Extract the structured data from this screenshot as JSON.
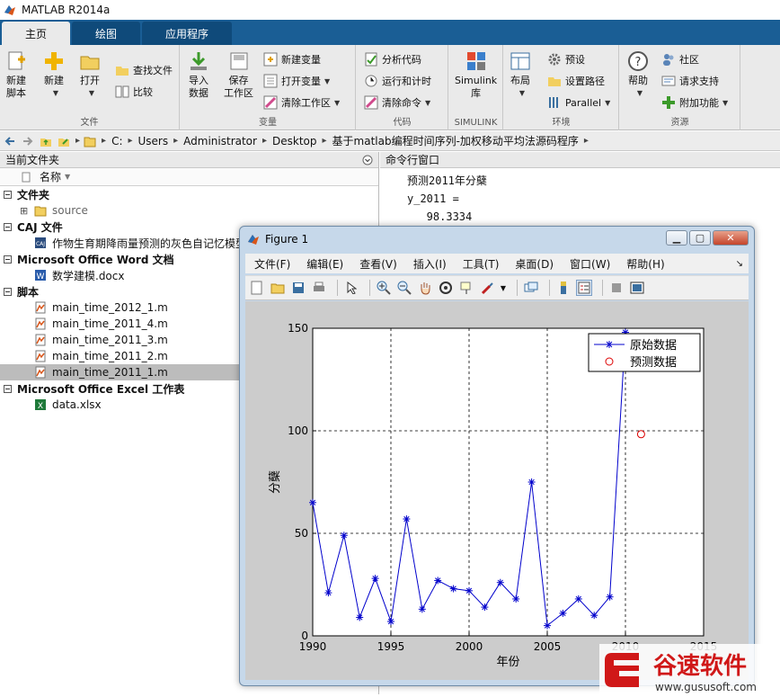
{
  "window": {
    "title": "MATLAB R2014a"
  },
  "tabs": [
    {
      "label": "主页"
    },
    {
      "label": "绘图"
    },
    {
      "label": "应用程序"
    }
  ],
  "ribbon": {
    "file": {
      "group_label": "文件",
      "new_script": "新建\n脚本",
      "new": "新建",
      "open": "打开",
      "find_files": "查找文件",
      "compare": "比较"
    },
    "variable": {
      "group_label": "变量",
      "import_data": "导入\n数据",
      "save_workspace": "保存\n工作区",
      "new_variable": "新建变量",
      "open_variable": "打开变量",
      "clear_workspace": "清除工作区"
    },
    "code": {
      "group_label": "代码",
      "analyze_code": "分析代码",
      "run_and_time": "运行和计时",
      "clear_commands": "清除命令"
    },
    "simulink": {
      "group_label": "SIMULINK",
      "library": "Simulink\n库"
    },
    "environment": {
      "group_label": "环境",
      "layout": "布局",
      "preferences": "预设",
      "set_path": "设置路径",
      "parallel": "Parallel"
    },
    "resources": {
      "group_label": "资源",
      "help": "帮助",
      "community": "社区",
      "request_support": "请求支持",
      "add_ons": "附加功能"
    }
  },
  "address": {
    "crumbs": [
      "C:",
      "Users",
      "Administrator",
      "Desktop",
      "基于matlab编程时间序列-加权移动平均法源码程序"
    ]
  },
  "current_folder": {
    "title": "当前文件夹",
    "column_name": "名称",
    "groups": [
      {
        "title": "文件夹",
        "items": [
          {
            "name": "source",
            "icon": "folder-icon"
          }
        ]
      },
      {
        "title": "CAJ 文件",
        "items": [
          {
            "name": "作物生育期降雨量预测的灰色自记忆模型",
            "icon": "caj-icon"
          }
        ]
      },
      {
        "title": "Microsoft Office Word 文档",
        "items": [
          {
            "name": "数学建模.docx",
            "icon": "word-icon"
          }
        ]
      },
      {
        "title": "脚本",
        "items": [
          {
            "name": "main_time_2012_1.m",
            "icon": "m-file-icon"
          },
          {
            "name": "main_time_2011_4.m",
            "icon": "m-file-icon"
          },
          {
            "name": "main_time_2011_3.m",
            "icon": "m-file-icon"
          },
          {
            "name": "main_time_2011_2.m",
            "icon": "m-file-icon"
          },
          {
            "name": "main_time_2011_1.m",
            "icon": "m-file-icon",
            "selected": true
          }
        ]
      },
      {
        "title": "Microsoft Office Excel 工作表",
        "items": [
          {
            "name": "data.xlsx",
            "icon": "excel-icon"
          }
        ]
      }
    ]
  },
  "command_window": {
    "title": "命令行窗口",
    "lines": [
      "预测2011年分蘖",
      "y_2011 =",
      "   98.3334"
    ]
  },
  "figure": {
    "title": "Figure 1",
    "menu": [
      "文件(F)",
      "编辑(E)",
      "查看(V)",
      "插入(I)",
      "工具(T)",
      "桌面(D)",
      "窗口(W)",
      "帮助(H)"
    ]
  },
  "chart_data": {
    "type": "line",
    "xlabel": "年份",
    "ylabel": "分蘖",
    "xlim": [
      1990,
      2015
    ],
    "ylim": [
      0,
      150
    ],
    "xticks": [
      1990,
      1995,
      2000,
      2005,
      2010,
      2015
    ],
    "yticks": [
      0,
      50,
      100,
      150
    ],
    "grid": true,
    "legend_position": "top-right",
    "series": [
      {
        "name": "原始数据",
        "color": "#0000cc",
        "marker": "*",
        "x": [
          1990,
          1991,
          1992,
          1993,
          1994,
          1995,
          1996,
          1997,
          1998,
          1999,
          2000,
          2001,
          2002,
          2003,
          2004,
          2005,
          2006,
          2007,
          2008,
          2009,
          2010
        ],
        "y": [
          65,
          21,
          49,
          9,
          28,
          7,
          57,
          13,
          27,
          23,
          22,
          14,
          26,
          18,
          75,
          5,
          11,
          18,
          10,
          19,
          148
        ]
      },
      {
        "name": "预测数据",
        "color": "#dd0000",
        "marker": "o",
        "x": [
          2011
        ],
        "y": [
          98.3334
        ]
      }
    ]
  },
  "watermark": {
    "brand": "谷速软件",
    "url": "www.gususoft.com",
    "color": "#d01818"
  }
}
